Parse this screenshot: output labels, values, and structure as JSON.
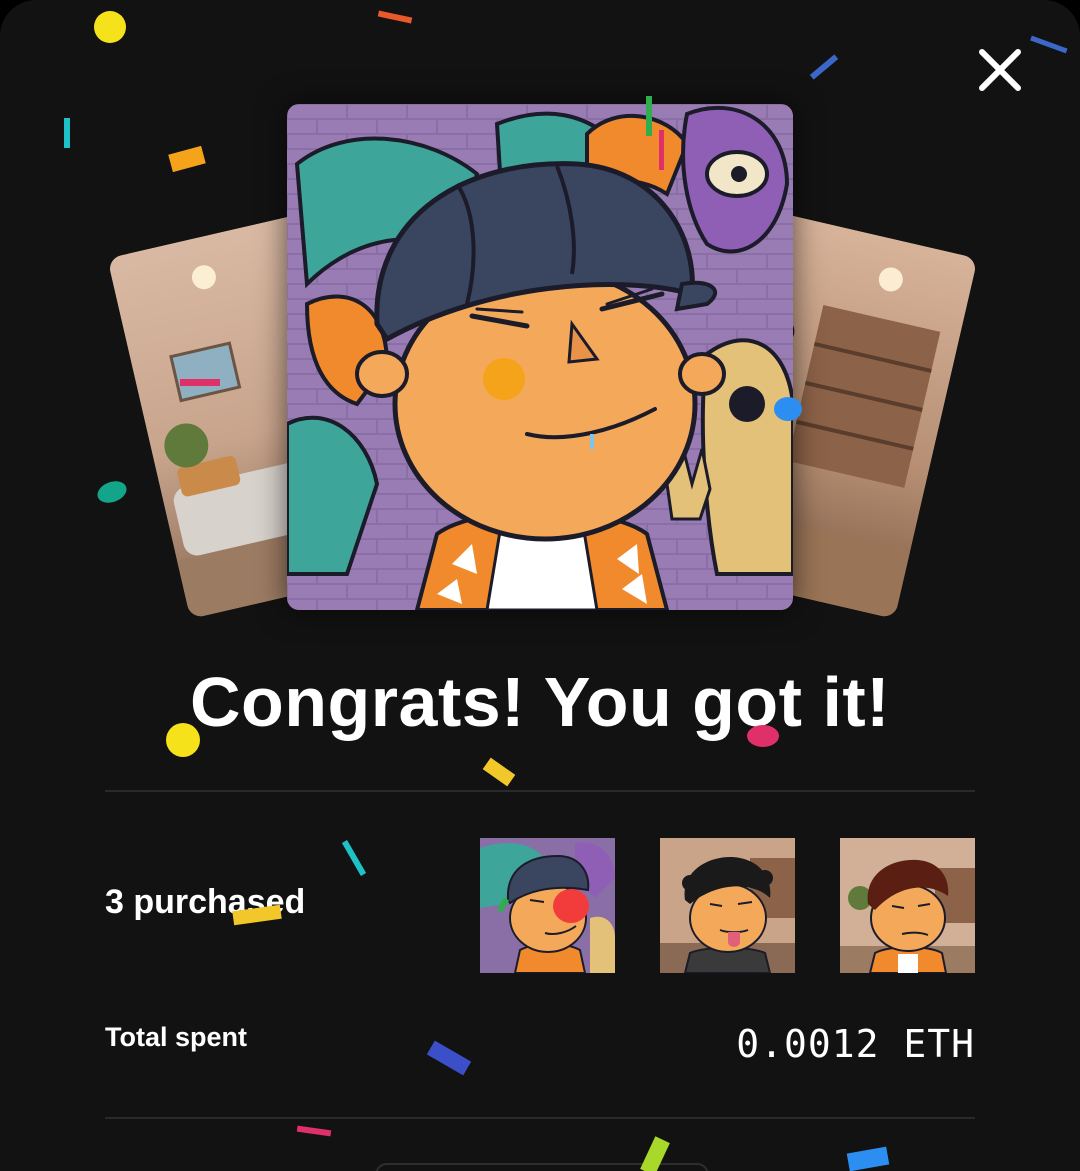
{
  "modal": {
    "close_icon": "close-icon",
    "headline": "Congrats! You got it!"
  },
  "cards": [
    {
      "name": "nft-card-left",
      "theme": "living-room",
      "hair": "brown"
    },
    {
      "name": "nft-card-main",
      "theme": "graffiti-wall",
      "hair": "cap"
    },
    {
      "name": "nft-card-right",
      "theme": "bookshelf-room",
      "hair": "black-curly"
    }
  ],
  "summary": {
    "purchased_label": "3 purchased",
    "total_label": "Total spent",
    "total_value": "0.0012 ETH"
  },
  "colors": {
    "background": "#121212",
    "text": "#ffffff",
    "divider": "#2a2a2a",
    "skin": "#f4a95a",
    "cap": "#3a4560",
    "jacket": "#f08a2c"
  }
}
